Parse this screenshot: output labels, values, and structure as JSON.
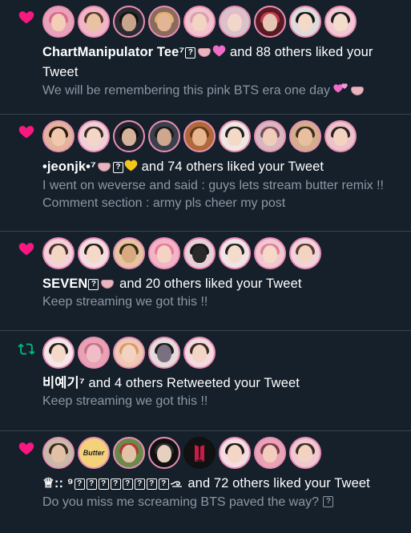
{
  "notifications": [
    {
      "type": "like",
      "icon": "heart-icon",
      "avatars": [
        "pink",
        "pink",
        "dark",
        "pink",
        "pink",
        "pink",
        "dark",
        "pink",
        "pink"
      ],
      "actor": "ChartManipulator Tee⁷",
      "action": "and 88 others liked your Tweet",
      "tweet_lines": [
        "We will be remembering this pink BTS era one day"
      ]
    },
    {
      "type": "like",
      "icon": "heart-icon",
      "avatars": [
        "pink",
        "pink",
        "pink",
        "pink",
        "pink",
        "pink",
        "pink",
        "pink",
        "pink"
      ],
      "actor": "•jeonjk•⁷",
      "action": "and 74 others liked your Tweet",
      "tweet_lines": [
        "I went on weverse and said : guys lets stream butter remix !!",
        "Comment section : army pls cheer my post"
      ]
    },
    {
      "type": "like",
      "icon": "heart-icon",
      "avatars": [
        "pink",
        "pink",
        "pink",
        "pink",
        "pink",
        "pink",
        "pink",
        "pink",
        "pink"
      ],
      "actor": "SEVEN",
      "action": "and 20 others liked your Tweet",
      "tweet_lines": [
        "Keep streaming we got this !!"
      ]
    },
    {
      "type": "retweet",
      "icon": "retweet-icon",
      "avatars": [
        "pink",
        "pink",
        "pink",
        "pink",
        "pink"
      ],
      "actor": "비예기⁷",
      "action": "and 4 others Retweeted your Tweet",
      "tweet_lines": [
        "Keep streaming we got this !!"
      ]
    },
    {
      "type": "like",
      "icon": "heart-icon",
      "avatars": [
        "pink",
        "Butter",
        "pink",
        "dark",
        "BTS",
        "pink",
        "pink",
        "pink"
      ],
      "actor": "♕:: ⁹",
      "action": "and 72 others liked your Tweet",
      "tweet_lines": [
        "Do you miss me screaming BTS paved the way?"
      ]
    }
  ],
  "colors": {
    "background": "#15202b",
    "like": "#f91880",
    "retweet": "#00ba7c",
    "muted": "#8b98a5",
    "divider": "#38444d",
    "avatar_ring": "#ea8fb4"
  }
}
